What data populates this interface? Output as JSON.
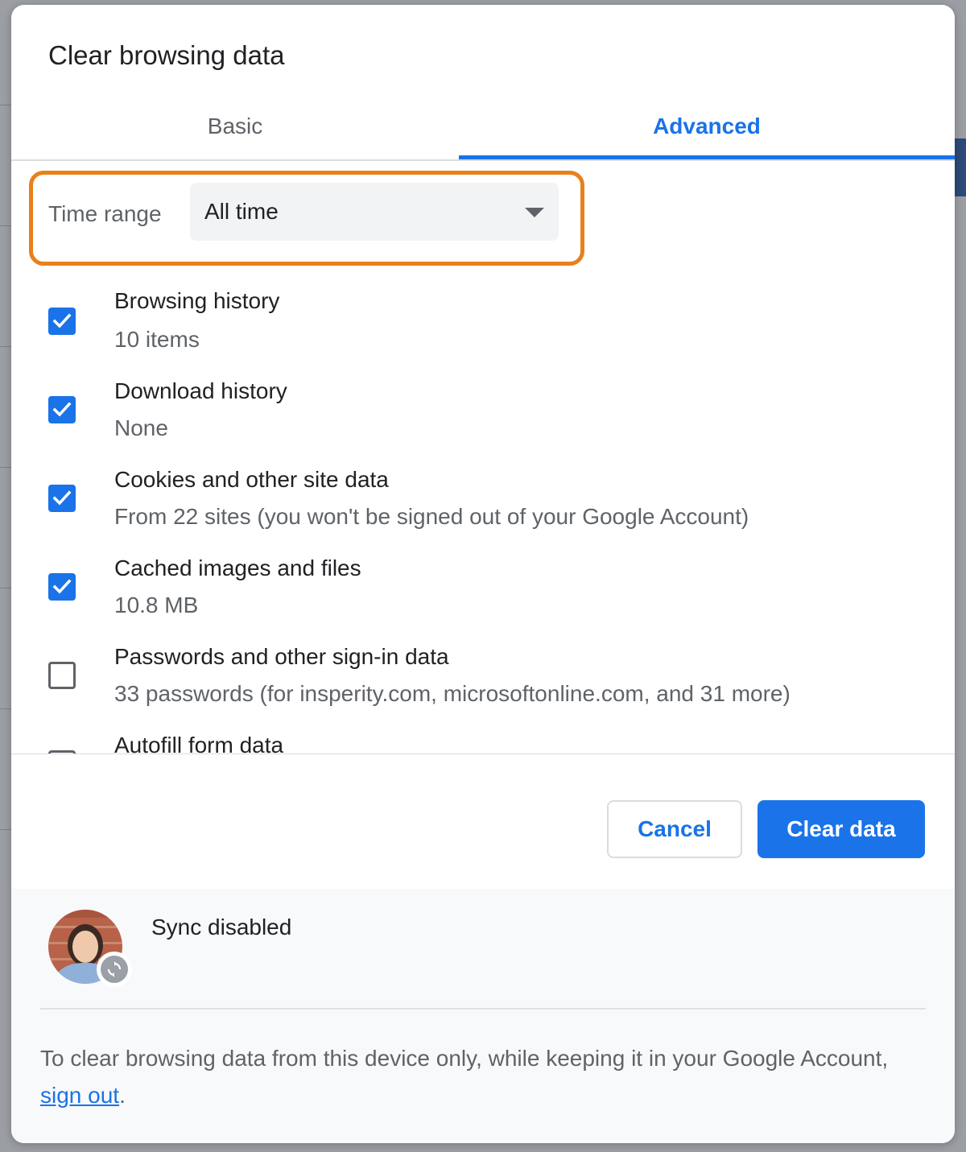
{
  "dialog": {
    "title": "Clear browsing data"
  },
  "tabs": {
    "basic": "Basic",
    "advanced": "Advanced",
    "selected": "Advanced"
  },
  "time_range": {
    "label": "Time range",
    "value": "All time"
  },
  "items": [
    {
      "title": "Browsing history",
      "subtitle": "10 items",
      "checked": true
    },
    {
      "title": "Download history",
      "subtitle": "None",
      "checked": true
    },
    {
      "title": "Cookies and other site data",
      "subtitle": "From 22 sites (you won't be signed out of your Google Account)",
      "checked": true
    },
    {
      "title": "Cached images and files",
      "subtitle": "10.8 MB",
      "checked": true
    },
    {
      "title": "Passwords and other sign-in data",
      "subtitle": "33 passwords (for insperity.com, microsoftonline.com, and 31 more)",
      "checked": false
    },
    {
      "title": "Autofill form data",
      "checked": false
    }
  ],
  "buttons": {
    "cancel": "Cancel",
    "clear": "Clear data"
  },
  "footer": {
    "sync_status": "Sync disabled",
    "note_prefix": "To clear browsing data from this device only, while keeping it in your Google Account, ",
    "note_link": "sign out",
    "note_suffix": "."
  },
  "colors": {
    "accent": "#1a73e8",
    "highlight": "#e8801b",
    "secondary_text": "#5f6368"
  },
  "icons": {
    "checkbox_checked": "checkmark-icon",
    "dropdown": "caret-down-icon",
    "sync": "sync-icon"
  }
}
